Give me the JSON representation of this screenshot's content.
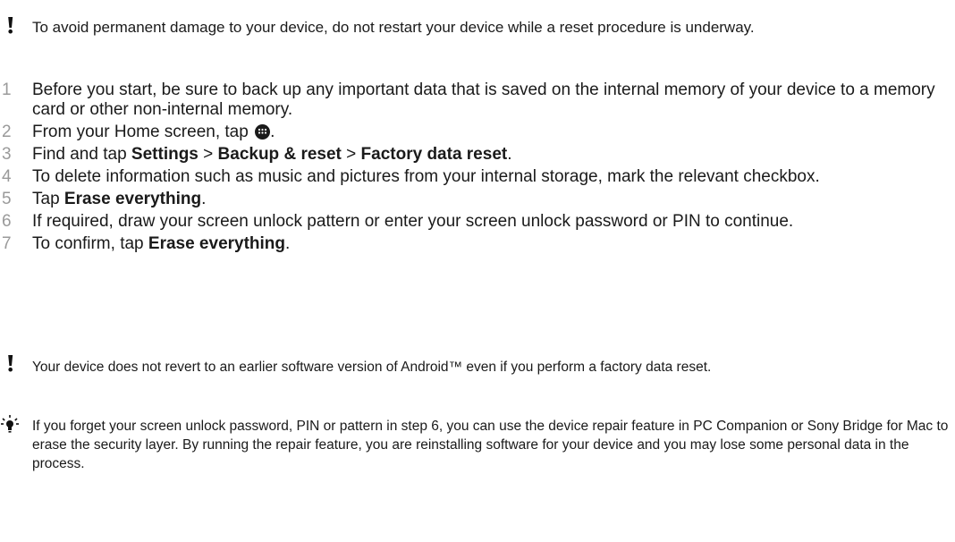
{
  "warning_top": {
    "icon": "exclamation-icon",
    "text": "To avoid permanent damage to your device, do not restart your device while a reset procedure is underway."
  },
  "steps": [
    {
      "number": "1",
      "text": "Before you start, be sure to back up any important data that is saved on the internal memory of your device to a memory card or other non-internal memory."
    },
    {
      "number": "2",
      "text_before": "From your Home screen, tap ",
      "icon": "apps-grid-icon",
      "text_after": "."
    },
    {
      "number": "3",
      "prefix": "Find and tap ",
      "b1": "Settings",
      "sep1": " > ",
      "b2": "Backup & reset",
      "sep2": " > ",
      "b3": "Factory data reset",
      "suffix": "."
    },
    {
      "number": "4",
      "text": "To delete information such as music and pictures from your internal storage, mark the relevant checkbox."
    },
    {
      "number": "5",
      "prefix": "Tap ",
      "bold": "Erase everything",
      "suffix": "."
    },
    {
      "number": "6",
      "text": "If required, draw your screen unlock pattern or enter your screen unlock password or PIN to continue."
    },
    {
      "number": "7",
      "prefix": "To confirm, tap ",
      "bold": "Erase everything",
      "suffix": "."
    }
  ],
  "warning_bottom": {
    "icon": "exclamation-icon",
    "text": "Your device does not revert to an earlier software version of Android™ even if you perform a factory data reset."
  },
  "tip": {
    "icon": "lightbulb-icon",
    "text": "If you forget your screen unlock password, PIN or pattern in step 6, you can use the device repair feature in PC Companion or Sony Bridge for Mac to erase the security layer. By running the repair feature, you are reinstalling software for your device and you may lose some personal data in the process."
  }
}
